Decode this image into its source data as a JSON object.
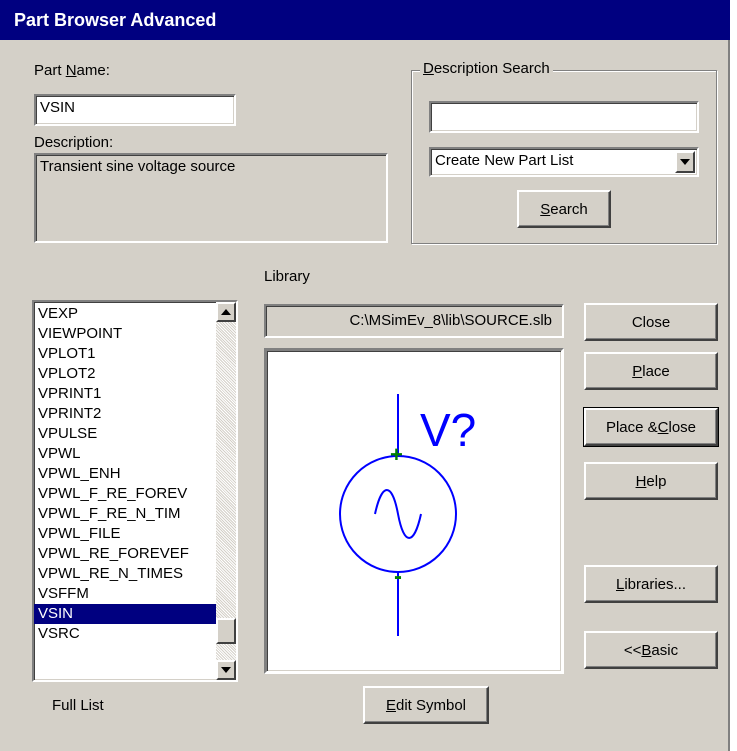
{
  "window": {
    "title": "Part Browser Advanced"
  },
  "part_name": {
    "label_pre": "Part ",
    "label_key": "N",
    "label_post": "ame:",
    "value": "VSIN"
  },
  "description": {
    "label": "Description:",
    "text": "Transient sine voltage source"
  },
  "description_search": {
    "label_key": "D",
    "label_post": "escription Search",
    "query": "",
    "dropdown_selected": "Create New Part List",
    "search_key": "S",
    "search_post": "earch"
  },
  "library": {
    "label": "Library",
    "path": "C:\\MSimEv_8\\lib\\SOURCE.slb"
  },
  "parts_list": {
    "items": [
      "VEXP",
      "VIEWPOINT",
      "VPLOT1",
      "VPLOT2",
      "VPRINT1",
      "VPRINT2",
      "VPULSE",
      "VPWL",
      "VPWL_ENH",
      "VPWL_F_RE_FOREV",
      "VPWL_F_RE_N_TIM",
      "VPWL_FILE",
      "VPWL_RE_FOREVEF",
      "VPWL_RE_N_TIMES",
      "VSFFM",
      "VSIN",
      "VSRC"
    ],
    "selected": "VSIN",
    "footer": "Full List"
  },
  "symbol_preview": {
    "refdes": "V?",
    "plus": "+",
    "minus": "-"
  },
  "buttons": {
    "close": "Close",
    "place_key": "P",
    "place_post": "lace",
    "place_close_pre": "Place & ",
    "place_close_key": "C",
    "place_close_post": "lose",
    "help_key": "H",
    "help_post": "elp",
    "libraries_key": "L",
    "libraries_post": "ibraries...",
    "basic_pre": "<< ",
    "basic_key": "B",
    "basic_post": "asic",
    "edit_symbol_key": "E",
    "edit_symbol_post": "dit Symbol"
  },
  "colors": {
    "titlebar": "#000080",
    "face": "#d4d0c8",
    "symbol": "#0000ff",
    "pins": "#008000"
  }
}
